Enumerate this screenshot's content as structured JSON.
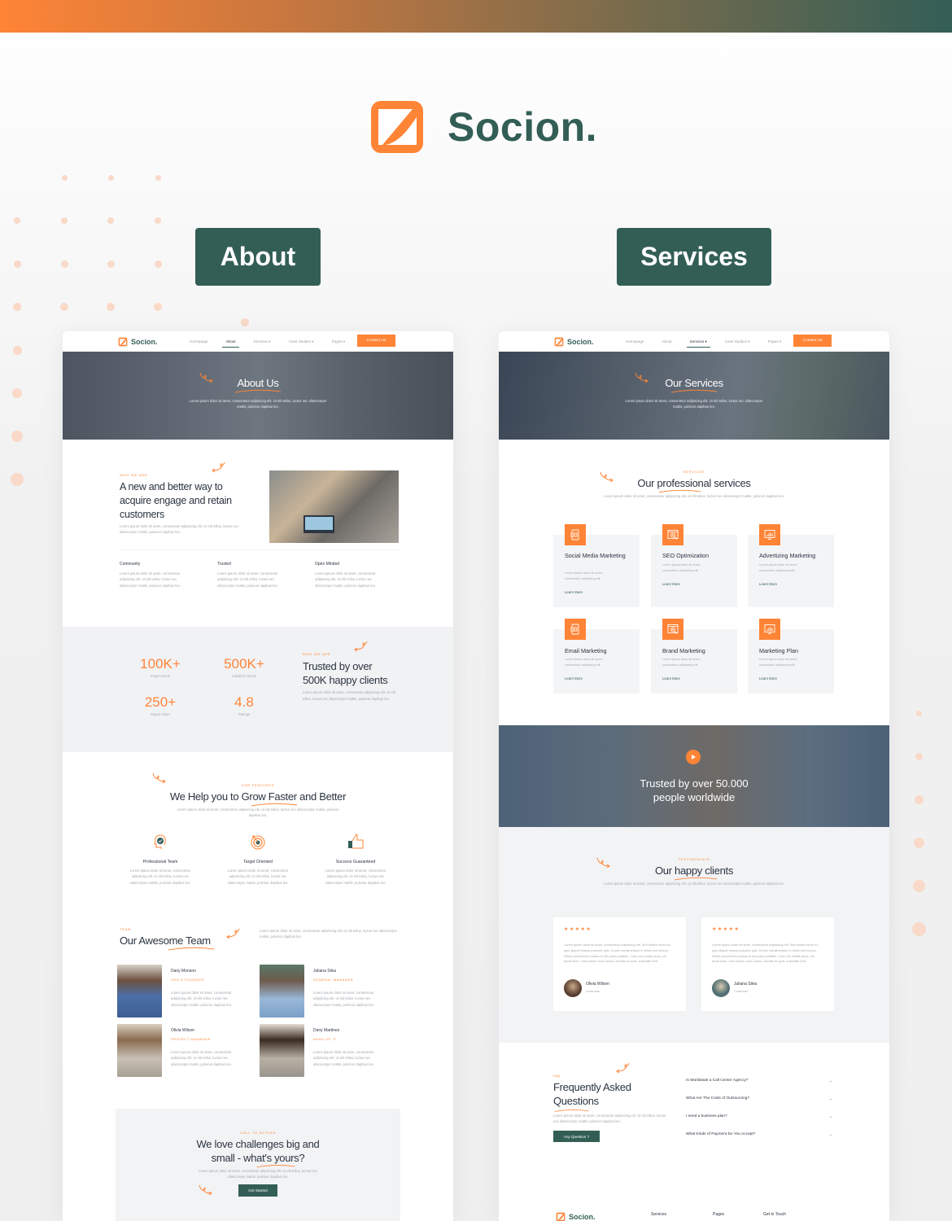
{
  "brand": {
    "name": "Socion.",
    "accent": "#ff8436",
    "primary": "#335e56"
  },
  "tags": {
    "about": "About",
    "services": "Services"
  },
  "nav": {
    "items": [
      "Homepage",
      "About",
      "Services ▾",
      "Case Studies ▾",
      "Pages ▾"
    ],
    "cta": "Contact Us"
  },
  "lorem": {
    "short": "Lorem ipsum dolor sit amet, consectetur adipiscing elit. Ut elit tellus, luctus nec ullamcorper mattis, pulvinar dapibus leo.",
    "card": "Lorem ipsum dolor sit amet, consectetur adipiscing elit.",
    "review": "Lorem ipsum dolor sit amet, consectetur adipiscing elit. Sed finibus tortor ex, quis aliquet massa posuere quis. Donec condimentum in tellus sed cursus. Etiam consectetur massa in nisi porta sodales. Cras non mattis lacus, vel porta risus. Cras auctor nunc luctus, lobortis ex quis, vulputate erat."
  },
  "about_page": {
    "hero": {
      "title": "About Us",
      "text": "Lorem ipsum dolor sit amet, consectetur adipiscing elit. Ut elit tellus, luctus nec ullamcorper mattis, pulvinar dapibus leo."
    },
    "who": {
      "eyebrow": "WHO WE ARE",
      "title": "A new and better way to acquire engage and retain customers",
      "text": "Lorem ipsum dolor sit amet, consectetur adipiscing elit. Ut elit tellus, luctus nec ullamcorper mattis, pulvinar dapibus leo.",
      "values": [
        {
          "title": "Community",
          "text": "Lorem ipsum dolor sit amet, consectetur adipiscing elit. Ut elit tellus, luctus nec ullamcorper mattis, pulvinar dapibus leo."
        },
        {
          "title": "Trusted",
          "text": "Lorem ipsum dolor sit amet, consectetur adipiscing elit. Ut elit tellus, luctus nec ullamcorper mattis, pulvinar dapibus leo."
        },
        {
          "title": "Open Minded",
          "text": "Lorem ipsum dolor sit amet, consectetur adipiscing elit. Ut elit tellus, luctus nec ullamcorper mattis, pulvinar dapibus leo."
        }
      ]
    },
    "stats": {
      "items": [
        {
          "value": "100K+",
          "label": "Project Done"
        },
        {
          "value": "500K+",
          "label": "Satisfied Clients"
        },
        {
          "value": "250+",
          "label": "Expert Team"
        },
        {
          "value": "4.8",
          "label": "Ratings"
        }
      ],
      "eyebrow": "WHO WE ARE",
      "title": "Trusted by over 500K happy clients",
      "text": "Lorem ipsum dolor sit amet, consectetur adipiscing elit. Ut elit tellus, luctus nec ullamcorper mattis, pulvinar dapibus leo."
    },
    "features": {
      "eyebrow": "OUR FEATURES",
      "title": "We Help you to Grow Faster and Better",
      "text": "Lorem ipsum dolor sit amet, consectetur adipiscing elit. Ut elit tellus, luctus nec ullamcorper mattis, pulvinar dapibus leo.",
      "items": [
        {
          "icon": "head-check-icon",
          "title": "Professional Team",
          "text": "Lorem ipsum dolor sit amet, consectetur adipiscing elit. Ut elit tellus, luctus nec ullamcorper mattis, pulvinar dapibus leo."
        },
        {
          "icon": "target-icon",
          "title": "Target Oriented",
          "text": "Lorem ipsum dolor sit amet, consectetur adipiscing elit. Ut elit tellus, luctus nec ullamcorper mattis, pulvinar dapibus leo."
        },
        {
          "icon": "thumbs-up-icon",
          "title": "Success Guaranteed",
          "text": "Lorem ipsum dolor sit amet, consectetur adipiscing elit. Ut elit tellus, luctus nec ullamcorper mattis, pulvinar dapibus leo."
        }
      ]
    },
    "team": {
      "eyebrow": "TEAM",
      "title": "Our Awesome Team",
      "text": "Lorem ipsum dolor sit amet, consectetur adipiscing elit. Ut elit tellus, luctus nec ullamcorper mattis, pulvinar dapibus leo.",
      "members": [
        {
          "name": "Dany Monson",
          "role": "CEO & FOUNDER",
          "text": "Lorem ipsum dolor sit amet, consectetur adipiscing elit. Ut elit tellus, luctus nec ullamcorper mattis, pulvinar dapibus leo."
        },
        {
          "name": "Juliana Silva",
          "role": "GENERAL MANAGER",
          "text": "Lorem ipsum dolor sit amet, consectetur adipiscing elit. Ut elit tellus, luctus nec ullamcorper mattis, pulvinar dapibus leo."
        },
        {
          "name": "Olivia Wilson",
          "role": "PROJECT MANAGER",
          "text": "Lorem ipsum dolor sit amet, consectetur adipiscing elit. Ut elit tellus, luctus nec ullamcorper mattis, pulvinar dapibus leo."
        },
        {
          "name": "Dany Martinez",
          "role": "HEAD OF IT",
          "text": "Lorem ipsum dolor sit amet, consectetur adipiscing elit. Ut elit tellus, luctus nec ullamcorper mattis, pulvinar dapibus leo."
        }
      ]
    },
    "cta": {
      "eyebrow": "CALL TO ACTION",
      "title_line1": "We love challenges big and",
      "title_line2": "small - what's yours?",
      "text": "Lorem ipsum dolor sit amet, consectetur adipiscing elit. Ut elit tellus, luctus nec ullamcorper mattis, pulvinar dapibus leo.",
      "button": "Get Started"
    }
  },
  "services_page": {
    "hero": {
      "title": "Our Services",
      "text": "Lorem ipsum dolor sit amet, consectetur adipiscing elit. Ut elit tellus, luctus nec ullamcorper mattis, pulvinar dapibus leo."
    },
    "services": {
      "eyebrow": "SERVICES",
      "title": "Our professional services",
      "text": "Lorem ipsum dolor sit amet, consectetur adipiscing elit. Ut elit tellus, luctus nec ullamcorper mattis, pulvinar dapibus leo.",
      "items": [
        {
          "icon": "mobile-chat-icon",
          "title": "Social Media Marketing",
          "text": "Lorem ipsum dolor sit amet, consectetur adipiscing elit.",
          "link": "Learn More"
        },
        {
          "icon": "browser-target-icon",
          "title": "SEO Optimization",
          "text": "Lorem ipsum dolor sit amet, consectetur adipiscing elit.",
          "link": "Learn More"
        },
        {
          "icon": "monitor-chart-icon",
          "title": "Advertizing Marketing",
          "text": "Lorem ipsum dolor sit amet, consectetur adipiscing elit.",
          "link": "Learn More"
        },
        {
          "icon": "mobile-chat-icon",
          "title": "Email Marketing",
          "text": "Lorem ipsum dolor sit amet, consectetur adipiscing elit.",
          "link": "Learn More"
        },
        {
          "icon": "browser-target-icon",
          "title": "Brand Marketing",
          "text": "Lorem ipsum dolor sit amet, consectetur adipiscing elit.",
          "link": "Learn More"
        },
        {
          "icon": "monitor-chart-icon",
          "title": "Marketing Plan",
          "text": "Lorem ipsum dolor sit amet, consectetur adipiscing elit.",
          "link": "Learn More"
        }
      ]
    },
    "video": {
      "title_line1": "Trusted by over 50.000",
      "title_line2": "people worldwide"
    },
    "testimonials": {
      "eyebrow": "TESTIMONIALS",
      "title": "Our happy clients",
      "text": "Lorem ipsum dolor sit amet, consectetur adipiscing elit. Ut elit tellus, luctus nec ullamcorper mattis, pulvinar dapibus leo.",
      "items": [
        {
          "stars": "★★★★★",
          "rating": 5,
          "text": "Lorem ipsum dolor sit amet, consectetur adipiscing elit. Sed finibus tortor ex, quis aliquet massa posuere quis. Donec condimentum in tellus sed cursus. Etiam consectetur massa in nisi porta sodales. Cras non mattis lacus, vel porta risus. Cras auctor nunc luctus, lobortis ex quis, vulputate erat.",
          "name": "Olivia Wilson",
          "role": "Costumer"
        },
        {
          "stars": "★★★★★",
          "rating": 5,
          "text": "Lorem ipsum dolor sit amet, consectetur adipiscing elit. Sed finibus tortor ex, quis aliquet massa posuere quis. Donec condimentum in tellus sed cursus. Etiam consectetur massa in nisi porta sodales. Cras non mattis lacus, vel porta risus. Cras auctor nunc luctus, lobortis ex quis, vulputate erat.",
          "name": "Juliana Silva",
          "role": "Costumer"
        }
      ]
    },
    "faq": {
      "eyebrow": "FAQ",
      "title_line1": "Frequently Asked",
      "title_line2": "Questions",
      "text": "Lorem ipsum dolor sit amet, consectetur adipiscing elit. Ut elit tellus, luctus nec ullamcorper mattis, pulvinar dapibus leo.",
      "button": "Any Question ?",
      "questions": [
        "Is Worldwide a Call Center Agency?",
        "What Are The Costs of Outsourcing?",
        "I need a business plan?",
        "What Kinds of Payment Do You Accept?"
      ]
    },
    "footer": {
      "columns": [
        "Services",
        "Pages",
        "Get in Touch"
      ]
    }
  }
}
